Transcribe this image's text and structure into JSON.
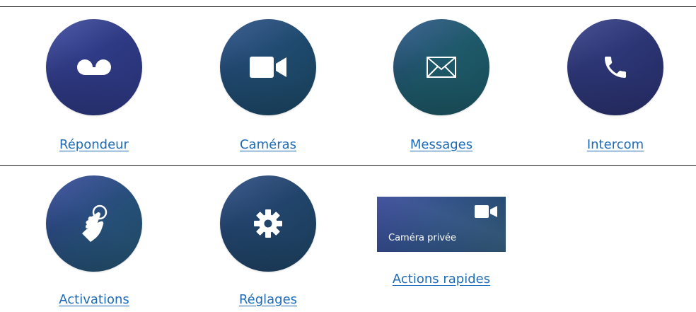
{
  "tiles": [
    {
      "label": "Répondeur",
      "icon": "voicemail-icon"
    },
    {
      "label": "Caméras",
      "icon": "video-camera-icon"
    },
    {
      "label": "Messages",
      "icon": "envelope-icon"
    },
    {
      "label": "Intercom",
      "icon": "phone-icon"
    },
    {
      "label": "Activations",
      "icon": "touch-hand-icon"
    },
    {
      "label": "Réglages",
      "icon": "gear-icon"
    },
    {
      "label": "Actions rapides",
      "icon": "video-camera-icon"
    }
  ],
  "quick_card": {
    "text": "Caméra privée"
  },
  "colors": {
    "link": "#1d6bb8",
    "icon": "#ffffff",
    "tile_primary": "#2e3a84",
    "tile_secondary": "#1f4a6e"
  }
}
